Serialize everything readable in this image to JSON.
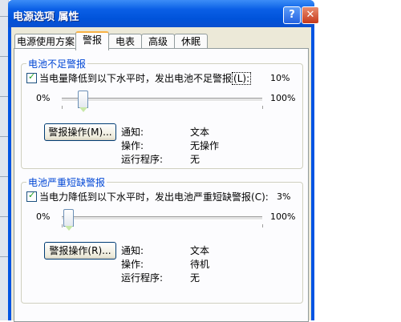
{
  "window": {
    "title": "电源选项 属性",
    "help_label": "?",
    "close_label": "✕"
  },
  "tabs": [
    {
      "label": "电源使用方案"
    },
    {
      "label": "警报"
    },
    {
      "label": "电表"
    },
    {
      "label": "高级"
    },
    {
      "label": "休眠"
    }
  ],
  "low_battery": {
    "group_label": "电池不足警报",
    "checkbox_label": "当电量降低到以下水平时，发出电池不足警报",
    "checkbox_accel": "(L)",
    "checkbox_colon": ":",
    "checked": true,
    "current_value": "10%",
    "slider_min": "0%",
    "slider_max": "100%",
    "slider_level_percent": 10,
    "button_label": "警报操作(M)...",
    "details": [
      {
        "key": "通知:",
        "value": "文本"
      },
      {
        "key": "操作:",
        "value": "无操作"
      },
      {
        "key": "运行程序:",
        "value": "无"
      }
    ]
  },
  "critical_battery": {
    "group_label": "电池严重短缺警报",
    "checkbox_label": "当电力降低到以下水平时，发出电池严重短缺警报",
    "checkbox_accel": "(C)",
    "checkbox_colon": ":",
    "checked": true,
    "current_value": "3%",
    "slider_min": "0%",
    "slider_max": "100%",
    "slider_level_percent": 3,
    "button_label": "警报操作(R)...",
    "details": [
      {
        "key": "通知:",
        "value": "文本"
      },
      {
        "key": "操作:",
        "value": "待机"
      },
      {
        "key": "运行程序:",
        "value": "无"
      }
    ]
  }
}
